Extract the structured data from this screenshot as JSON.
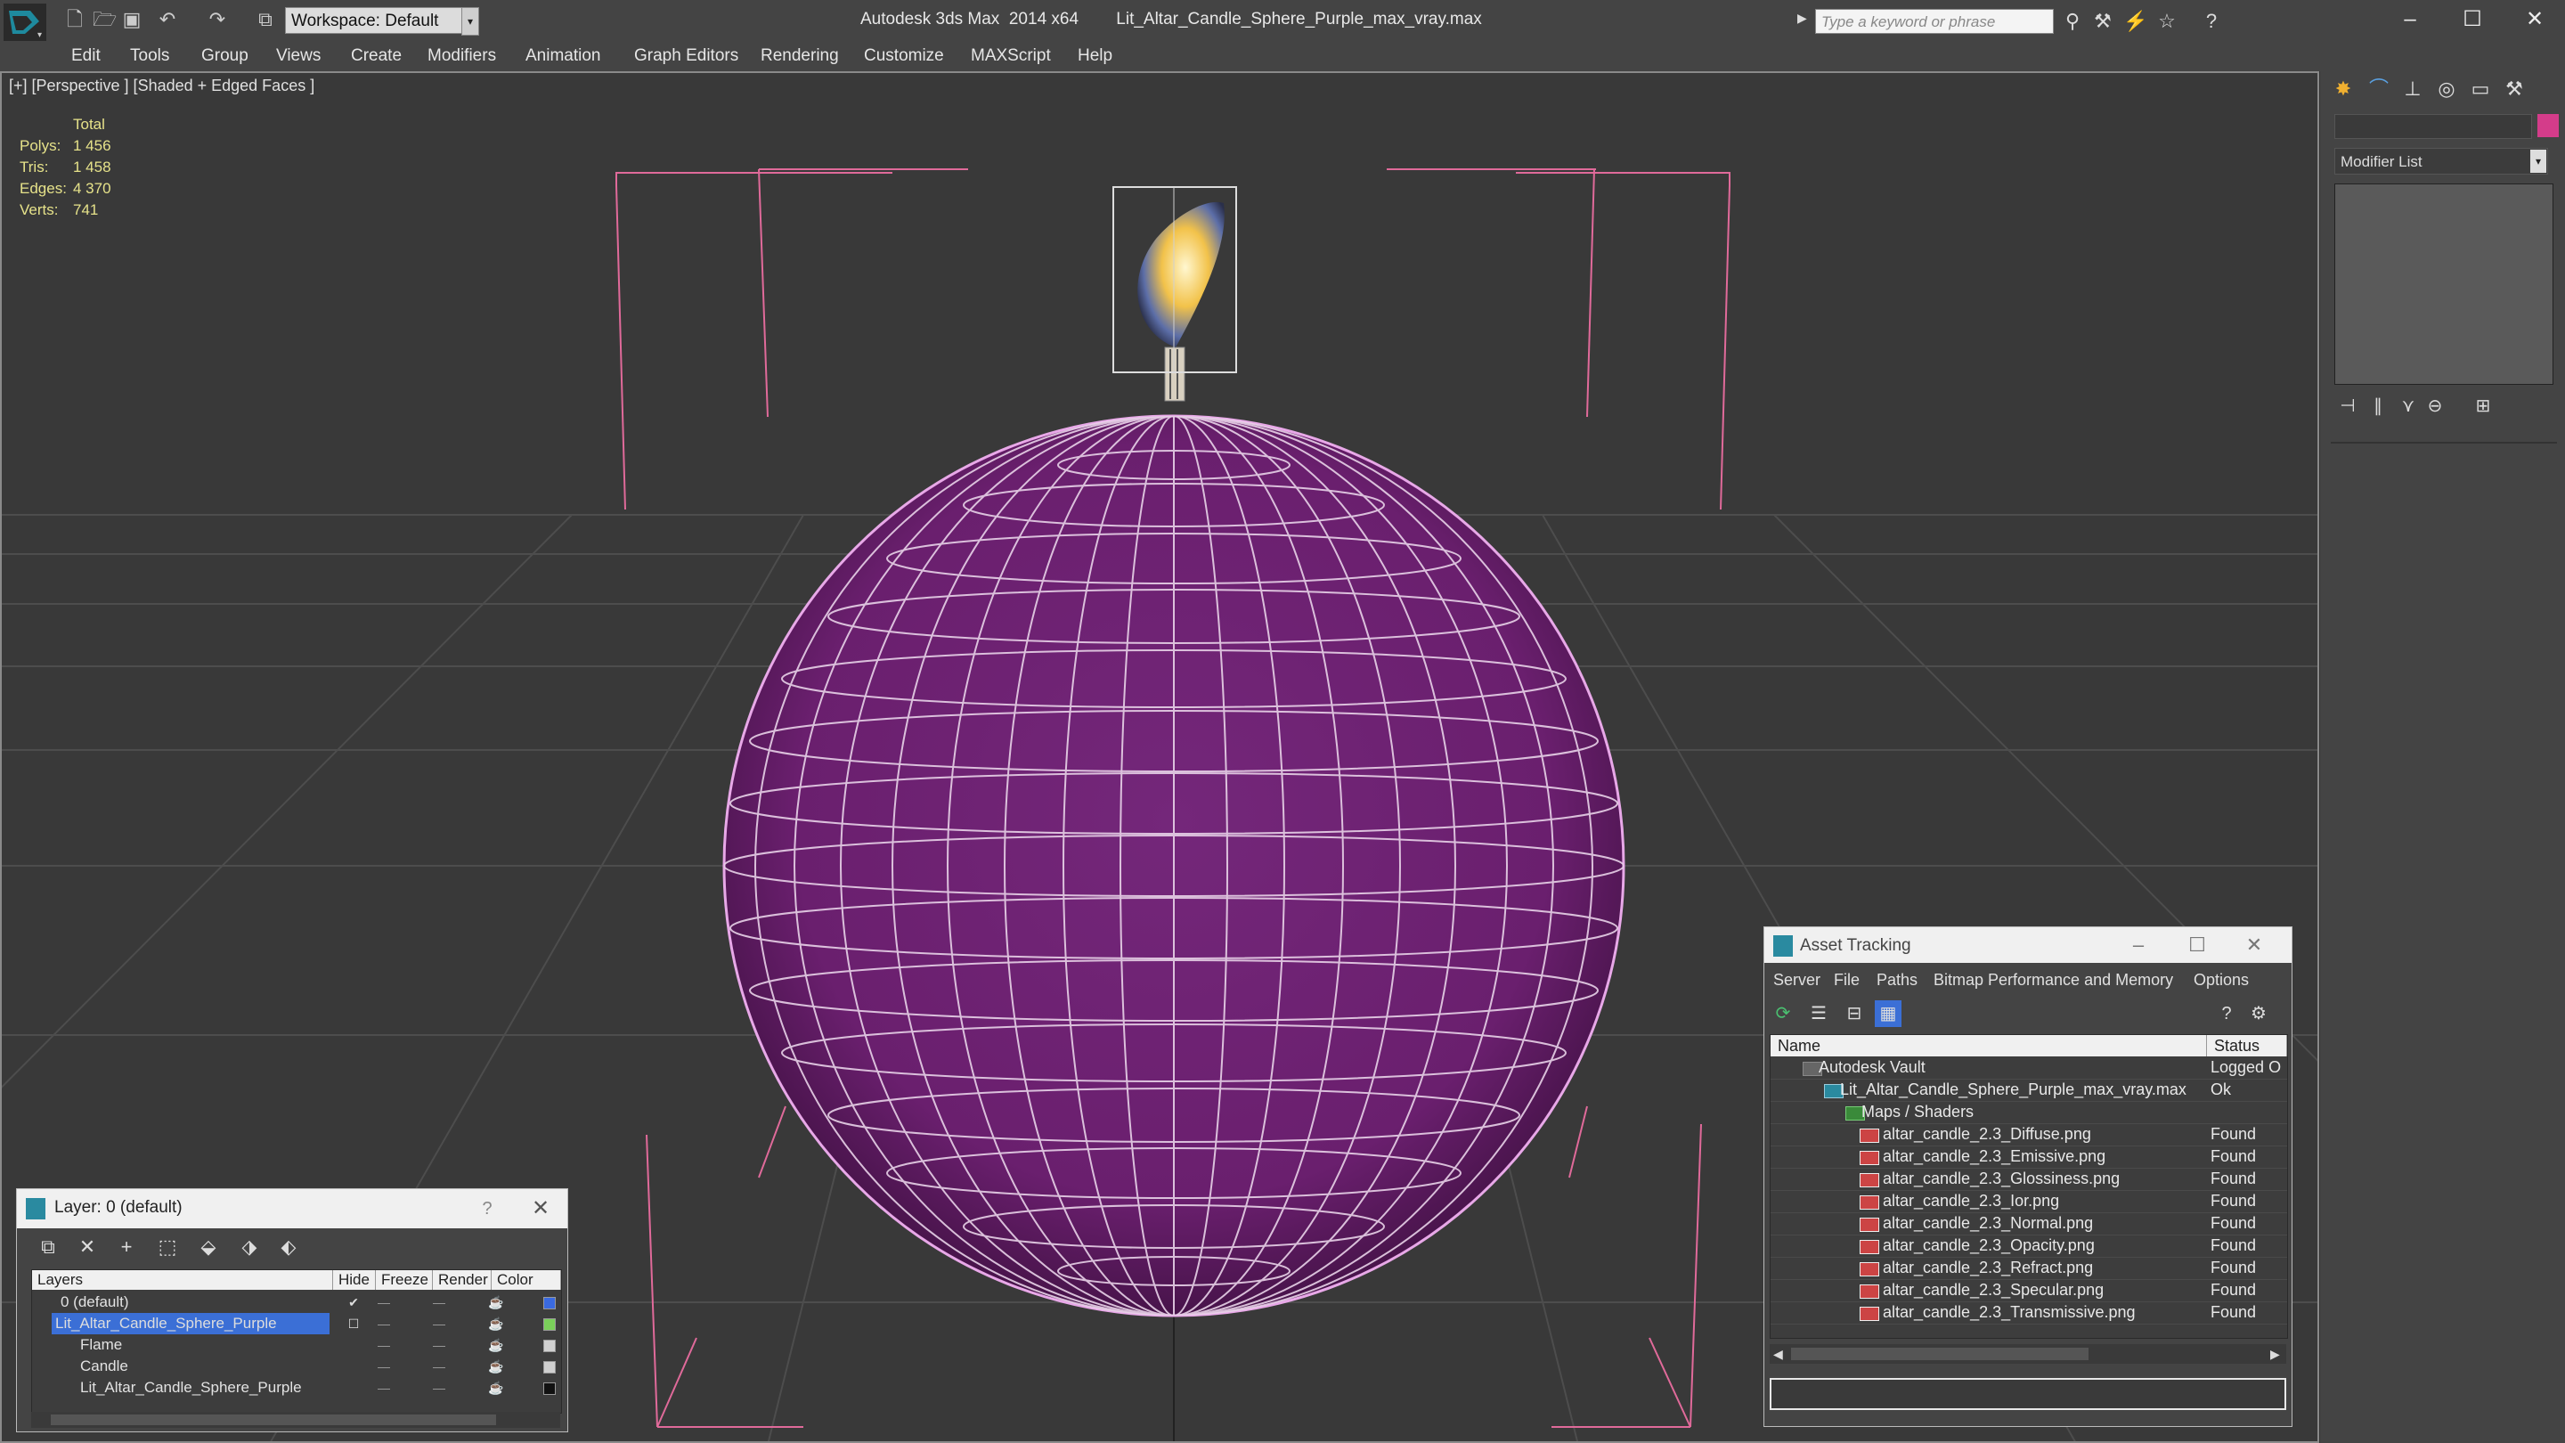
{
  "title_bar": {
    "app_title": "Autodesk 3ds Max  2014 x64",
    "file_name": "Lit_Altar_Candle_Sphere_Purple_max_vray.max",
    "workspace_label": "Workspace: Default",
    "search_placeholder": "Type a keyword or phrase"
  },
  "menu": [
    "Edit",
    "Tools",
    "Group",
    "Views",
    "Create",
    "Modifiers",
    "Animation",
    "Graph Editors",
    "Rendering",
    "Customize",
    "MAXScript",
    "Help"
  ],
  "viewport": {
    "label": "[+] [Perspective ] [Shaded + Edged Faces ]",
    "stats": {
      "header": "Total",
      "rows": [
        {
          "label": "Polys:",
          "value": "1 456"
        },
        {
          "label": "Tris:",
          "value": "1 458"
        },
        {
          "label": "Edges:",
          "value": "4 370"
        },
        {
          "label": "Verts:",
          "value": "741"
        }
      ]
    },
    "colors": {
      "sphere": "#6a1f6e",
      "wire": "#e8d2e8",
      "bounds": "#e06a9a"
    }
  },
  "command_panel": {
    "modifier_list": "Modifier List",
    "object_color": "#d43c8a"
  },
  "layer_window": {
    "title": "Layer: 0 (default)",
    "help": "?",
    "columns": [
      "Layers",
      "Hide",
      "Freeze",
      "Render",
      "Color"
    ],
    "rows": [
      {
        "name": "0 (default)",
        "color": "#3a6ae0"
      },
      {
        "name": "Lit_Altar_Candle_Sphere_Purple",
        "color": "#7ad05a"
      },
      {
        "name": "Flame",
        "color": "#d0d0d0"
      },
      {
        "name": "Candle",
        "color": "#d0d0d0"
      },
      {
        "name": "Lit_Altar_Candle_Sphere_Purple",
        "color": "#111111"
      }
    ]
  },
  "asset_tracking": {
    "title": "Asset Tracking",
    "menu": [
      "Server",
      "File",
      "Paths",
      "Bitmap Performance and Memory",
      "Options"
    ],
    "columns": [
      "Name",
      "Status"
    ],
    "rows": [
      {
        "name": "Autodesk Vault",
        "status": "Logged O"
      },
      {
        "name": "Lit_Altar_Candle_Sphere_Purple_max_vray.max",
        "status": "Ok"
      },
      {
        "name": "Maps / Shaders",
        "status": ""
      },
      {
        "name": "altar_candle_2.3_Diffuse.png",
        "status": "Found"
      },
      {
        "name": "altar_candle_2.3_Emissive.png",
        "status": "Found"
      },
      {
        "name": "altar_candle_2.3_Glossiness.png",
        "status": "Found"
      },
      {
        "name": "altar_candle_2.3_Ior.png",
        "status": "Found"
      },
      {
        "name": "altar_candle_2.3_Normal.png",
        "status": "Found"
      },
      {
        "name": "altar_candle_2.3_Opacity.png",
        "status": "Found"
      },
      {
        "name": "altar_candle_2.3_Refract.png",
        "status": "Found"
      },
      {
        "name": "altar_candle_2.3_Specular.png",
        "status": "Found"
      },
      {
        "name": "altar_candle_2.3_Transmissive.png",
        "status": "Found"
      }
    ]
  }
}
